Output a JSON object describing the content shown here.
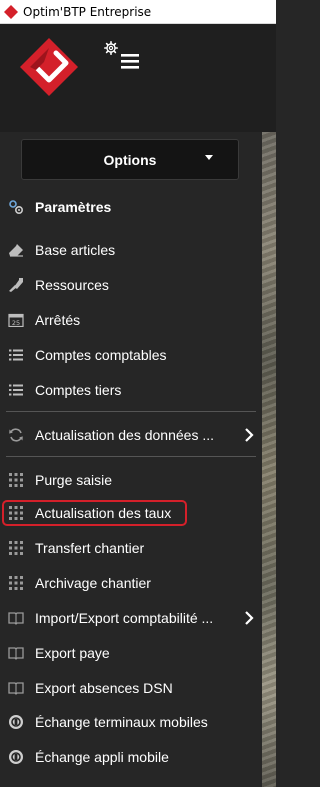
{
  "window": {
    "title": "Optim'BTP Entreprise"
  },
  "header": {
    "logo_icon": "optimbtp-logo",
    "menu_icons": [
      "gear-icon",
      "hamburger-icon"
    ]
  },
  "options_button": {
    "label": "Options"
  },
  "menu": {
    "section_title": "Paramètres",
    "items": [
      {
        "label": "Base articles",
        "icon": "eraser-icon"
      },
      {
        "label": "Ressources",
        "icon": "tools-icon"
      },
      {
        "label": "Arrêtés",
        "icon": "calendar-icon"
      },
      {
        "label": "Comptes comptables",
        "icon": "list-icon"
      },
      {
        "label": "Comptes tiers",
        "icon": "list-icon"
      },
      {
        "label": "Actualisation des données ...",
        "icon": "refresh-icon",
        "has_submenu": true
      },
      {
        "label": "Purge saisie",
        "icon": "grid-icon"
      },
      {
        "label": "Actualisation des taux",
        "icon": "grid-icon",
        "highlighted": true
      },
      {
        "label": "Transfert chantier",
        "icon": "grid-icon"
      },
      {
        "label": "Archivage chantier",
        "icon": "grid-icon"
      },
      {
        "label": "Import/Export comptabilité ...",
        "icon": "book-icon",
        "has_submenu": true
      },
      {
        "label": "Export paye",
        "icon": "book-icon"
      },
      {
        "label": "Export absences DSN",
        "icon": "book-icon"
      },
      {
        "label": "Échange terminaux mobiles",
        "icon": "mobile-sync-icon"
      },
      {
        "label": "Échange appli mobile",
        "icon": "mobile-sync-icon"
      }
    ]
  },
  "colors": {
    "accent": "#d4202a",
    "sidebar_bg": "#262626",
    "header_bg": "#1f1f1f",
    "text": "#ffffff"
  }
}
